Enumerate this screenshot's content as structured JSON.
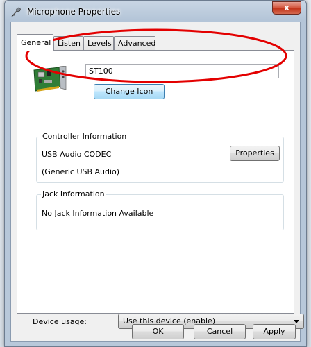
{
  "window": {
    "title": "Microphone Properties",
    "close_glyph": "x",
    "title_icon": "microphone-icon",
    "close_color": "#c7361c"
  },
  "tabs": [
    {
      "label": "General",
      "active": true
    },
    {
      "label": "Listen",
      "active": false
    },
    {
      "label": "Levels",
      "active": false
    },
    {
      "label": "Advanced",
      "active": false
    }
  ],
  "general": {
    "device_icon": "sound-card-icon",
    "device_name": "ST100",
    "change_icon_label": "Change Icon",
    "highlight_color": "#e30000",
    "controller": {
      "title": "Controller Information",
      "name": "USB Audio CODEC",
      "subtitle": "(Generic USB Audio)",
      "properties_label": "Properties"
    },
    "jack": {
      "title": "Jack Information",
      "message": "No Jack Information Available"
    },
    "device_usage": {
      "label": "Device usage:",
      "selected": "Use this device (enable)"
    }
  },
  "buttons": {
    "ok": "OK",
    "cancel": "Cancel",
    "apply": "Apply"
  }
}
